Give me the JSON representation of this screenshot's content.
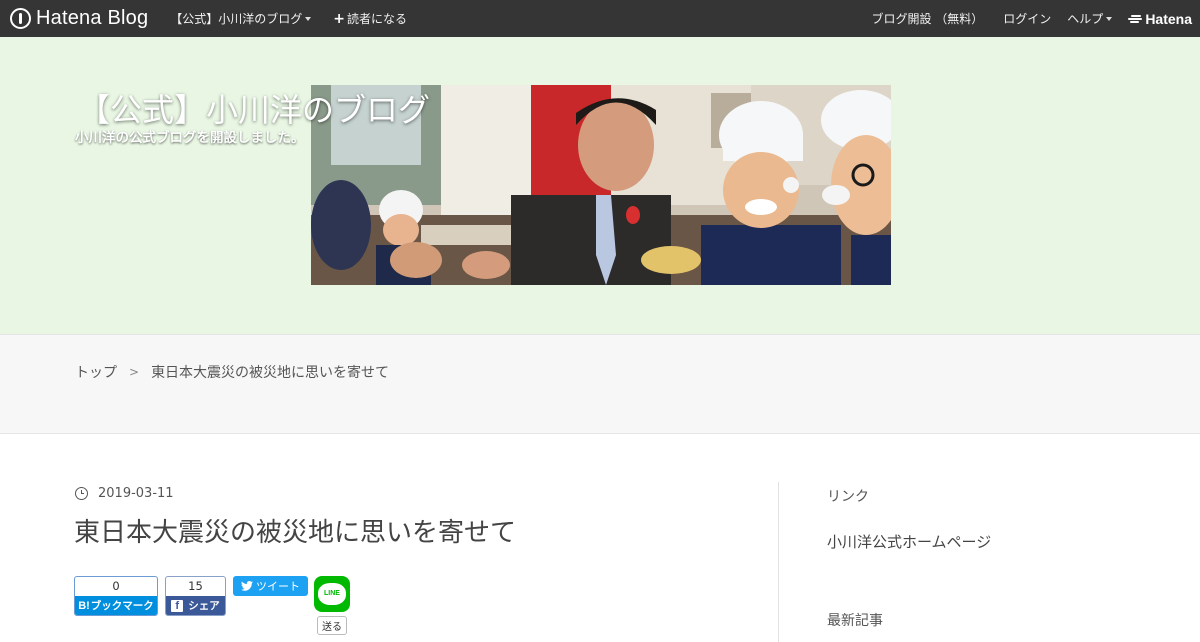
{
  "globalbar": {
    "logo_text": "Hatena Blog",
    "blog_menu_label": "【公式】小川洋のブログ",
    "subscribe_label": "読者になる",
    "open_blog_label": "ブログ開設 （無料）",
    "login_label": "ログイン",
    "help_label": "ヘルプ",
    "hatena_label": "Hatena"
  },
  "header": {
    "blog_title": "【公式】小川洋のブログ",
    "blog_description": "小川洋の公式ブログを開設しました。"
  },
  "breadcrumb": {
    "top_label": "トップ",
    "separator": ">",
    "current": "東日本大震災の被災地に思いを寄せて"
  },
  "entry": {
    "date": "2019-03-11",
    "title": "東日本大震災の被災地に思いを寄せて"
  },
  "share": {
    "hatena_count": "0",
    "hatena_label": "ブックマーク",
    "facebook_count": "15",
    "facebook_label": "シェア",
    "tweet_label": "ツイート",
    "line_icon_text": "LINE",
    "line_send_label": "送る"
  },
  "sidebar": {
    "links_heading": "リンク",
    "links": [
      "小川洋公式ホームページ"
    ],
    "recent_heading": "最新記事"
  },
  "colors": {
    "globalbar_bg": "#353535",
    "header_bg": "#e8f6e3",
    "hatena_bookmark": "#008fde",
    "facebook": "#3b5998",
    "twitter": "#1da1f2",
    "line": "#00b900"
  }
}
